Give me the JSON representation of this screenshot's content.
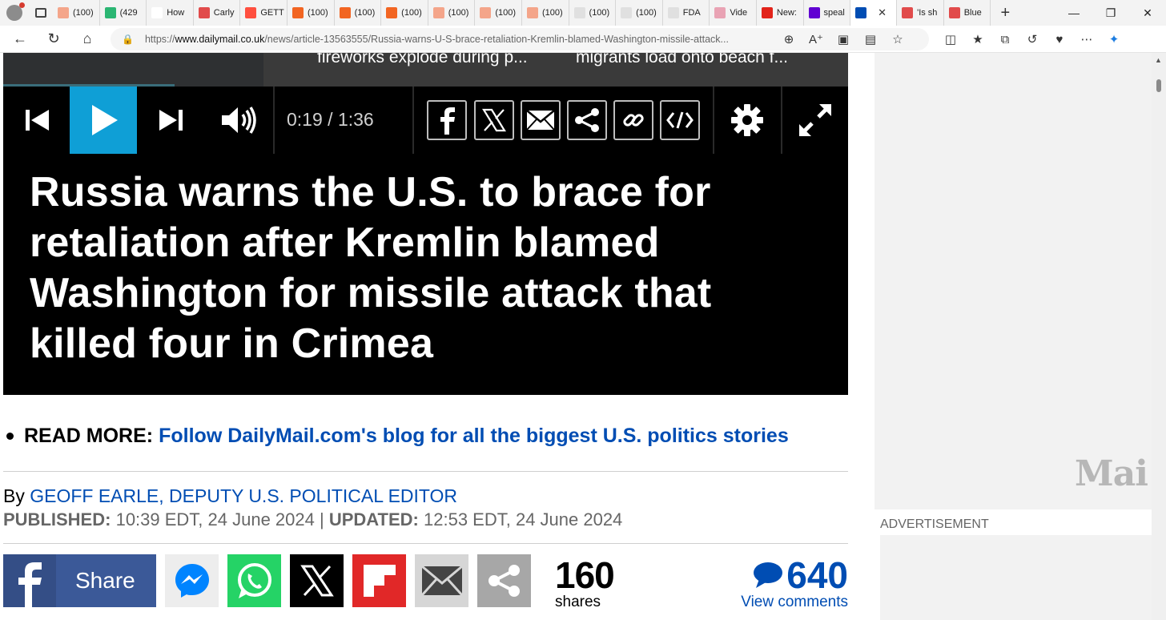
{
  "browser": {
    "tabs": [
      {
        "title": "(100)",
        "color": "#f4a58a"
      },
      {
        "title": "(429",
        "color": "#2bb673"
      },
      {
        "title": "How",
        "color": "#ffffff"
      },
      {
        "title": "Carly",
        "color": "#e14b4b"
      },
      {
        "title": "GETT",
        "color": "#ff4f3f"
      },
      {
        "title": "(100)",
        "color": "#f26522"
      },
      {
        "title": "(100)",
        "color": "#f26522"
      },
      {
        "title": "(100)",
        "color": "#f26522"
      },
      {
        "title": "(100)",
        "color": "#f4a58a"
      },
      {
        "title": "(100)",
        "color": "#f4a58a"
      },
      {
        "title": "(100)",
        "color": "#f4a58a"
      },
      {
        "title": "(100)",
        "color": "#e0e0e0"
      },
      {
        "title": "(100)",
        "color": "#e0e0e0"
      },
      {
        "title": "FDA",
        "color": "#e0e0e0"
      },
      {
        "title": "Vide",
        "color": "#e9a3b4"
      },
      {
        "title": "New:",
        "color": "#e2231a"
      },
      {
        "title": "speal",
        "color": "#6001d2"
      },
      {
        "title": "",
        "color": "#004db3",
        "active": true
      },
      {
        "title": "'Is sh",
        "color": "#e14b4b"
      },
      {
        "title": "Blue",
        "color": "#e14b4b"
      }
    ],
    "url_prefix": "https://",
    "url_domain": "www.dailymail.co.uk",
    "url_rest": "/news/article-13563555/Russia-warns-U-S-brace-retaliation-Kremlin-blamed-Washington-missile-attack..."
  },
  "video": {
    "captions": [
      "fireworks explode during p...",
      "migrants load onto beach f..."
    ],
    "time_current": "0:19",
    "time_separator": "/",
    "time_total": "1:36",
    "headline": "Russia warns the U.S. to brace for retaliation after Kremlin blamed Washington for missile attack that killed four in Crimea"
  },
  "article": {
    "read_more_label": "READ MORE:",
    "read_more_link": "Follow DailyMail.com's blog for all the biggest U.S. politics stories",
    "by_label": "By",
    "author": "GEOFF EARLE, DEPUTY U.S. POLITICAL EDITOR",
    "published_label": "PUBLISHED:",
    "published": "10:39 EDT, 24 June 2024",
    "separator": "|",
    "updated_label": "UPDATED:",
    "updated": "12:53 EDT, 24 June 2024"
  },
  "share": {
    "facebook_label": "Share",
    "shares_count": "160",
    "shares_label": "shares",
    "comments_count": "640",
    "comments_label": "View comments"
  },
  "sidebar": {
    "logo_text": "Mai",
    "ad_label": "ADVERTISEMENT"
  },
  "colors": {
    "accent_blue": "#004db3",
    "play_blue": "#0f9fd6",
    "facebook": "#3b5998",
    "messenger": "#0084ff",
    "whatsapp": "#25d366",
    "flipboard": "#e12828"
  }
}
